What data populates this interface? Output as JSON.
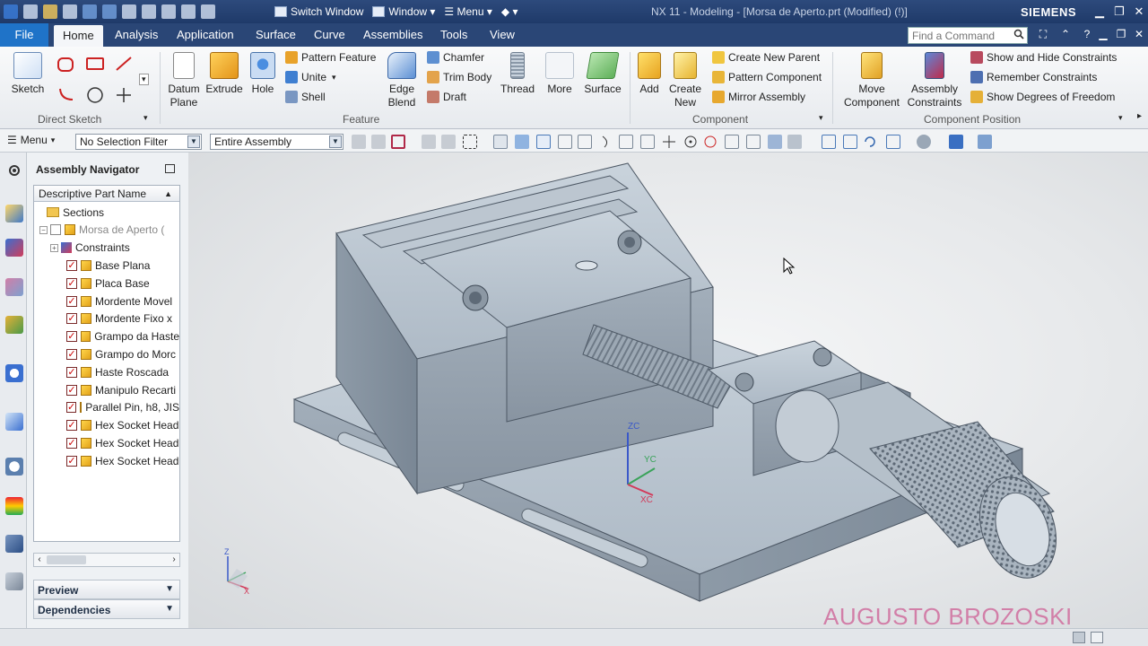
{
  "titlebar": {
    "switch_window": "Switch Window",
    "window": "Window",
    "menu": "Menu",
    "title": "NX 11 - Modeling - [Morsa de Aperto.prt (Modified)   (!)]",
    "brand": "SIEMENS"
  },
  "tabs": {
    "file": "File",
    "items": [
      "Home",
      "Analysis",
      "Application",
      "Surface",
      "Curve",
      "Assemblies",
      "Tools",
      "View"
    ],
    "find_placeholder": "Find a Command"
  },
  "ribbon": {
    "sketch": "Sketch",
    "direct_sketch": "Direct Sketch",
    "datum_plane": "Datum Plane",
    "extrude": "Extrude",
    "hole": "Hole",
    "pattern_feature": "Pattern Feature",
    "unite": "Unite",
    "shell": "Shell",
    "edge_blend": "Edge Blend",
    "chamfer": "Chamfer",
    "trim_body": "Trim Body",
    "draft": "Draft",
    "thread": "Thread",
    "more": "More",
    "feature": "Feature",
    "surface": "Surface",
    "add": "Add",
    "create_new": "Create New",
    "create_new_parent": "Create New Parent",
    "pattern_component": "Pattern Component",
    "mirror_assembly": "Mirror Assembly",
    "component": "Component",
    "move_component": "Move Component",
    "assembly_constraints": "Assembly Constraints",
    "show_hide_constraints": "Show and Hide Constraints",
    "remember_constraints": "Remember Constraints",
    "show_dof": "Show Degrees of Freedom",
    "component_position": "Component Position"
  },
  "selbar": {
    "menu": "Menu",
    "filter": "No Selection Filter",
    "scope": "Entire Assembly"
  },
  "navigator": {
    "title": "Assembly Navigator",
    "column": "Descriptive Part Name",
    "rows": [
      {
        "label": "Sections",
        "kind": "folder"
      },
      {
        "label": "Morsa de Aperto (",
        "kind": "root"
      },
      {
        "label": "Constraints",
        "kind": "constraints"
      },
      {
        "label": "Base Plana",
        "kind": "part"
      },
      {
        "label": "Placa Base",
        "kind": "part"
      },
      {
        "label": "Mordente Movel",
        "kind": "part"
      },
      {
        "label": "Mordente Fixo x",
        "kind": "part"
      },
      {
        "label": "Grampo da Haste",
        "kind": "part"
      },
      {
        "label": "Grampo do Morc",
        "kind": "part"
      },
      {
        "label": "Haste Roscada",
        "kind": "part"
      },
      {
        "label": "Manipulo Recarti",
        "kind": "part"
      },
      {
        "label": "Parallel Pin, h8, JIS",
        "kind": "part"
      },
      {
        "label": "Hex Socket Head",
        "kind": "part"
      },
      {
        "label": "Hex Socket Head",
        "kind": "part"
      },
      {
        "label": "Hex Socket Head",
        "kind": "part"
      }
    ],
    "preview": "Preview",
    "dependencies": "Dependencies"
  },
  "viewport": {
    "watermark": "AUGUSTO BROZOSKI",
    "axis_labels": {
      "z": "ZC",
      "y": "YC",
      "x": "XC"
    },
    "triad_labels": {
      "z": "Z",
      "x": "X"
    }
  }
}
